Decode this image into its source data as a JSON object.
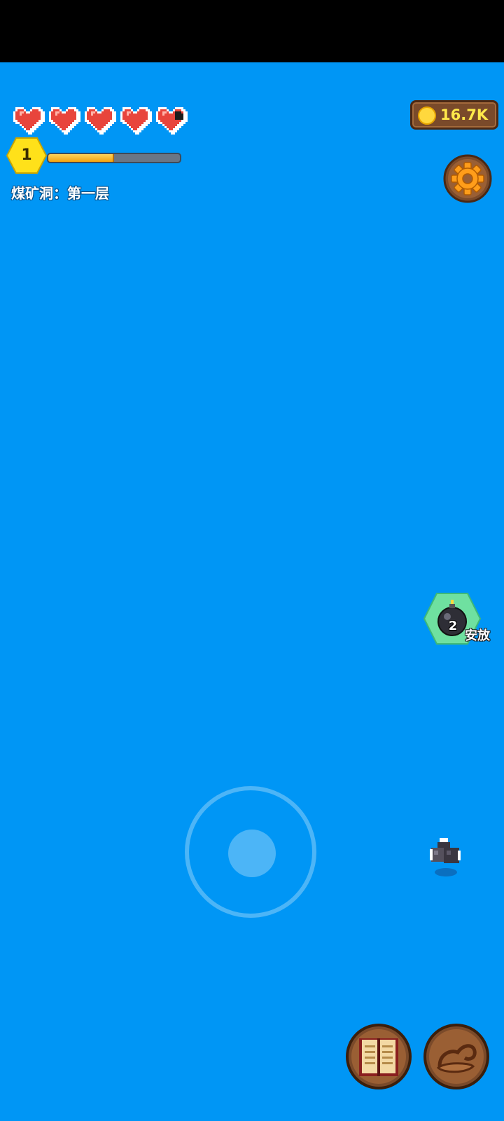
{
  "hud": {
    "hearts": {
      "full": 4,
      "partial": 1,
      "total": 5
    },
    "level": {
      "number": "1",
      "xp_progress": 0.5
    },
    "area_label": "煤矿洞：第一层",
    "coins": "16.7K"
  },
  "actions": {
    "bomb": {
      "count": "2",
      "label": "安放"
    }
  },
  "colors": {
    "background": "#0096f5",
    "heart": "#e8453c",
    "level_badge": "#ffe11a",
    "xp_fill": "#f4a30f",
    "coin_text": "#ffe94a",
    "bomb_badge": "#6fe0a0"
  },
  "icons": {
    "settings": "gear-icon",
    "book": "book-icon",
    "bag": "bag-icon",
    "bomb": "bomb-icon",
    "coin": "coin-icon",
    "heart": "heart-icon"
  }
}
